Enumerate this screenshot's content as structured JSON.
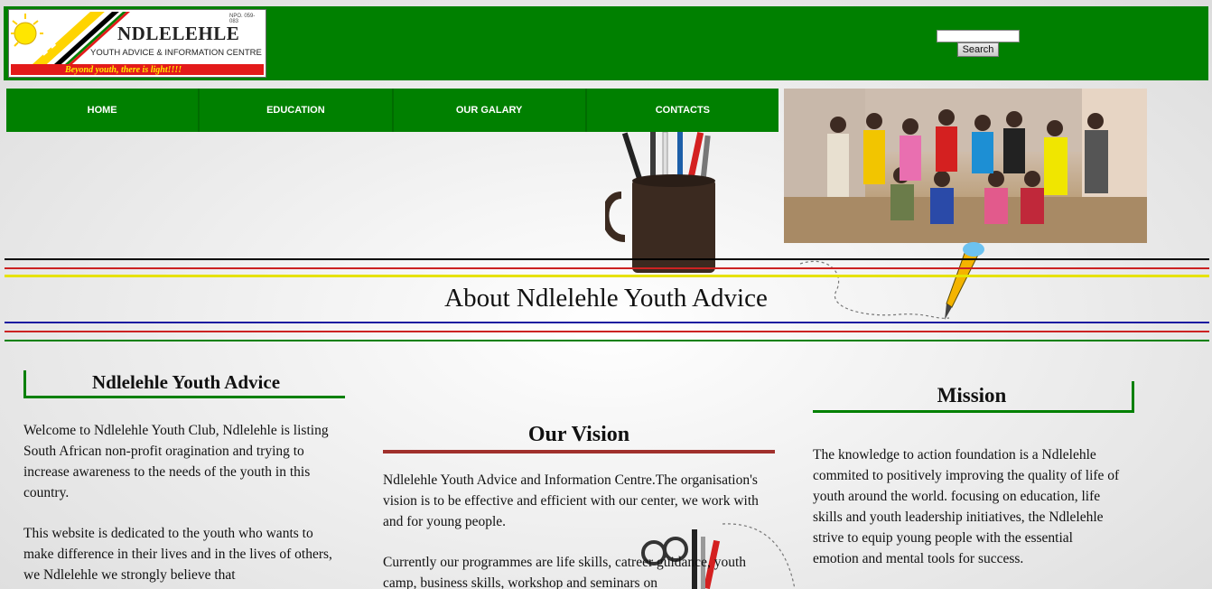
{
  "colors": {
    "brand_green": "#008000",
    "vision_red": "#a0302c",
    "line_black": "#000000",
    "line_red": "#cc2222",
    "line_yellow": "#e6e200",
    "line_blue": "#1a1aa0",
    "line_green": "#008000"
  },
  "header": {
    "logo": {
      "npo": "NPO. 059-083",
      "title": "NDLELEHLE",
      "subtitle": "YOUTH ADVICE & INFORMATION CENTRE",
      "tagline": "Beyond youth, there is light!!!!"
    },
    "search": {
      "value": "",
      "button_label": "Search"
    }
  },
  "nav": {
    "items": [
      {
        "label": "HOME"
      },
      {
        "label": "EDUCATION"
      },
      {
        "label": "OUR GALARY"
      },
      {
        "label": "CONTACTS"
      }
    ]
  },
  "banner": {
    "title": "About Ndlelehle Youth Advice"
  },
  "left": {
    "title": "Ndlelehle Youth Advice",
    "p1": "Welcome to Ndlelehle Youth Club, Ndlelehle is listing South African non-profit oragination and trying to increase awareness to the needs of the youth in this country.",
    "p2": "This website is dedicated to the youth who wants to make difference in their lives and in the lives of others, we Ndlelehle we strongly believe that"
  },
  "vision": {
    "title": "Our Vision",
    "p1": "Ndlelehle Youth Advice and Information Centre.The organisation's vision is to be effective and efficient with our center, we work with and for young people.",
    "p2": "Currently our programmes are life skills, catreer guidance, youth camp, business skills, workshop and seminars on"
  },
  "mission": {
    "title": "Mission",
    "p": "The knowledge to action foundation is a Ndlelehle commited to positively improving the quality of life of youth around the world. focusing on education, life skills and youth leadership initiatives, the Ndlelehle strive to equip young people with the essential emotion and mental tools for success."
  }
}
